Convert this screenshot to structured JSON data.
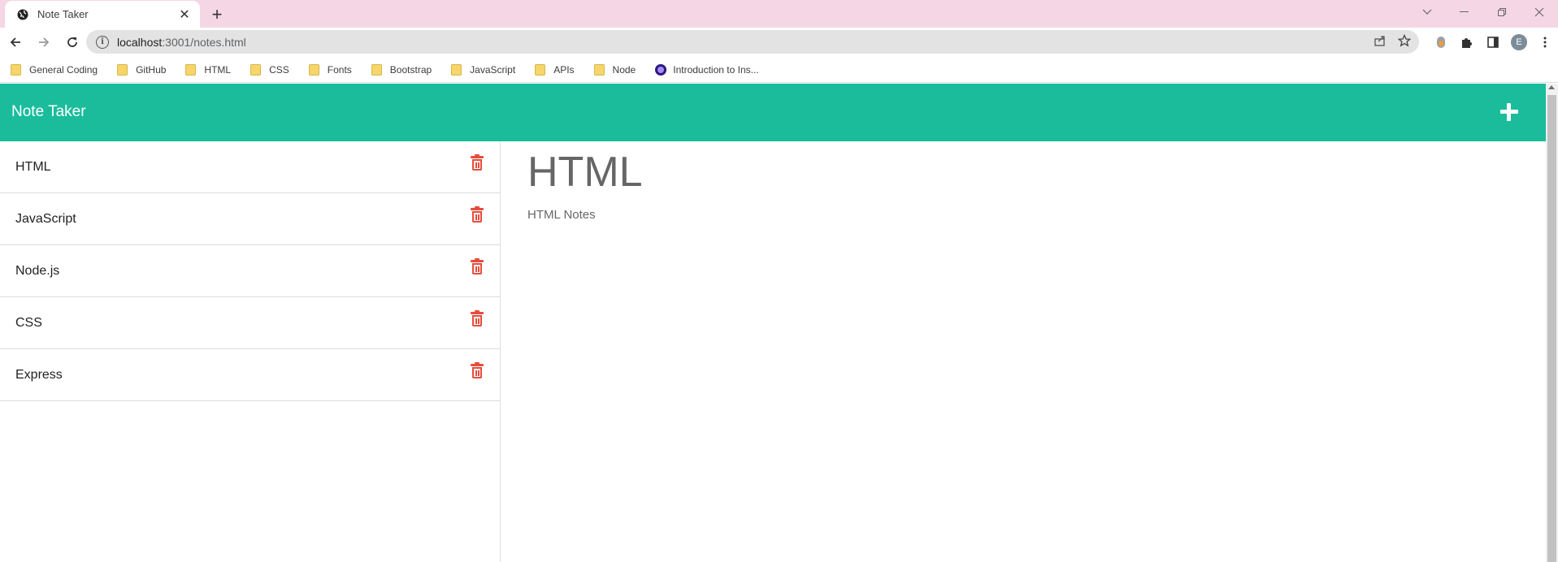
{
  "browser": {
    "tab_title": "Note Taker",
    "url_host": "localhost",
    "url_path": ":3001/notes.html",
    "profile_initial": "E",
    "bookmarks": [
      {
        "label": "General Coding",
        "icon": "folder-icon"
      },
      {
        "label": "GitHub",
        "icon": "folder-icon"
      },
      {
        "label": "HTML",
        "icon": "folder-icon"
      },
      {
        "label": "CSS",
        "icon": "folder-icon"
      },
      {
        "label": "Fonts",
        "icon": "folder-icon"
      },
      {
        "label": "Bootstrap",
        "icon": "folder-icon"
      },
      {
        "label": "JavaScript",
        "icon": "folder-icon"
      },
      {
        "label": "APIs",
        "icon": "folder-icon"
      },
      {
        "label": "Node",
        "icon": "folder-icon"
      },
      {
        "label": "Introduction to Ins...",
        "icon": "site-icon"
      }
    ]
  },
  "app": {
    "title": "Note Taker",
    "accent_color": "#1abc9c",
    "delete_color": "#e74c3c",
    "notes": [
      {
        "title": "HTML"
      },
      {
        "title": "JavaScript"
      },
      {
        "title": "Node.js"
      },
      {
        "title": "CSS"
      },
      {
        "title": "Express"
      }
    ],
    "active_note": {
      "title": "HTML",
      "text": "HTML Notes"
    }
  }
}
